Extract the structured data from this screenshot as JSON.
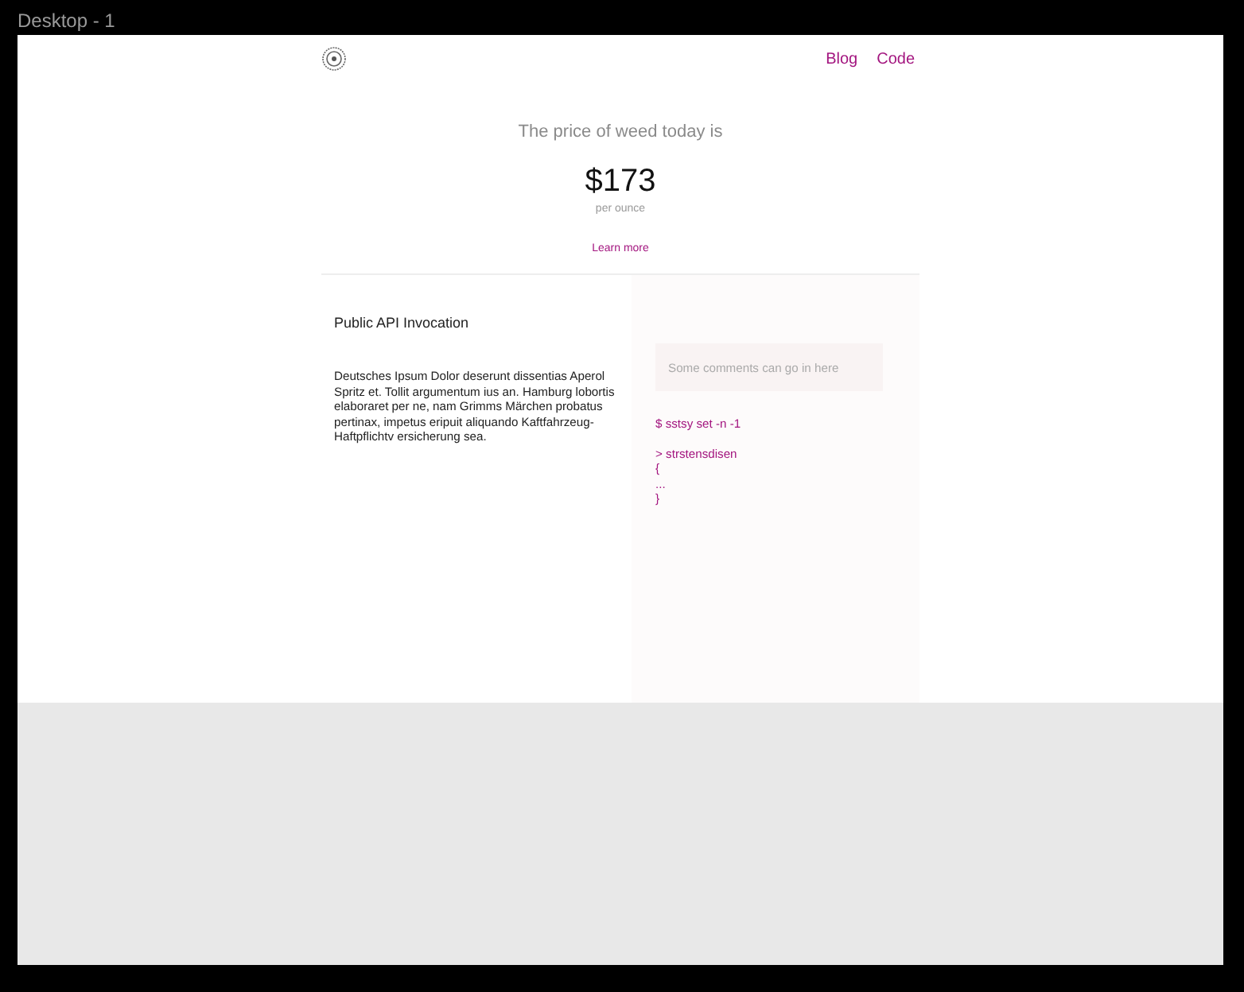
{
  "frame": {
    "title": "Desktop - 1"
  },
  "nav": {
    "links": [
      "Blog",
      "Code"
    ]
  },
  "hero": {
    "headline": "The price of weed today is",
    "price": "$173",
    "unit": "per ounce",
    "link": "Learn more"
  },
  "section": {
    "title": "Public API Invocation",
    "body": "Deutsches Ipsum Dolor deserunt dissentias Aperol Spritz et. Tollit argumentum ius an. Hamburg lobortis elaboraret per ne, nam Grimms Märchen probatus pertinax, impetus eripuit aliquando Kaftfahrzeug-Haftpflichtv ersicherung sea.",
    "comment": {
      "placeholder": "Some comments can go in here"
    },
    "code_blocks": [
      [
        "$ sstsy set -n -1"
      ],
      [
        "> strstensdisen",
        "{",
        "...",
        "}"
      ]
    ]
  }
}
